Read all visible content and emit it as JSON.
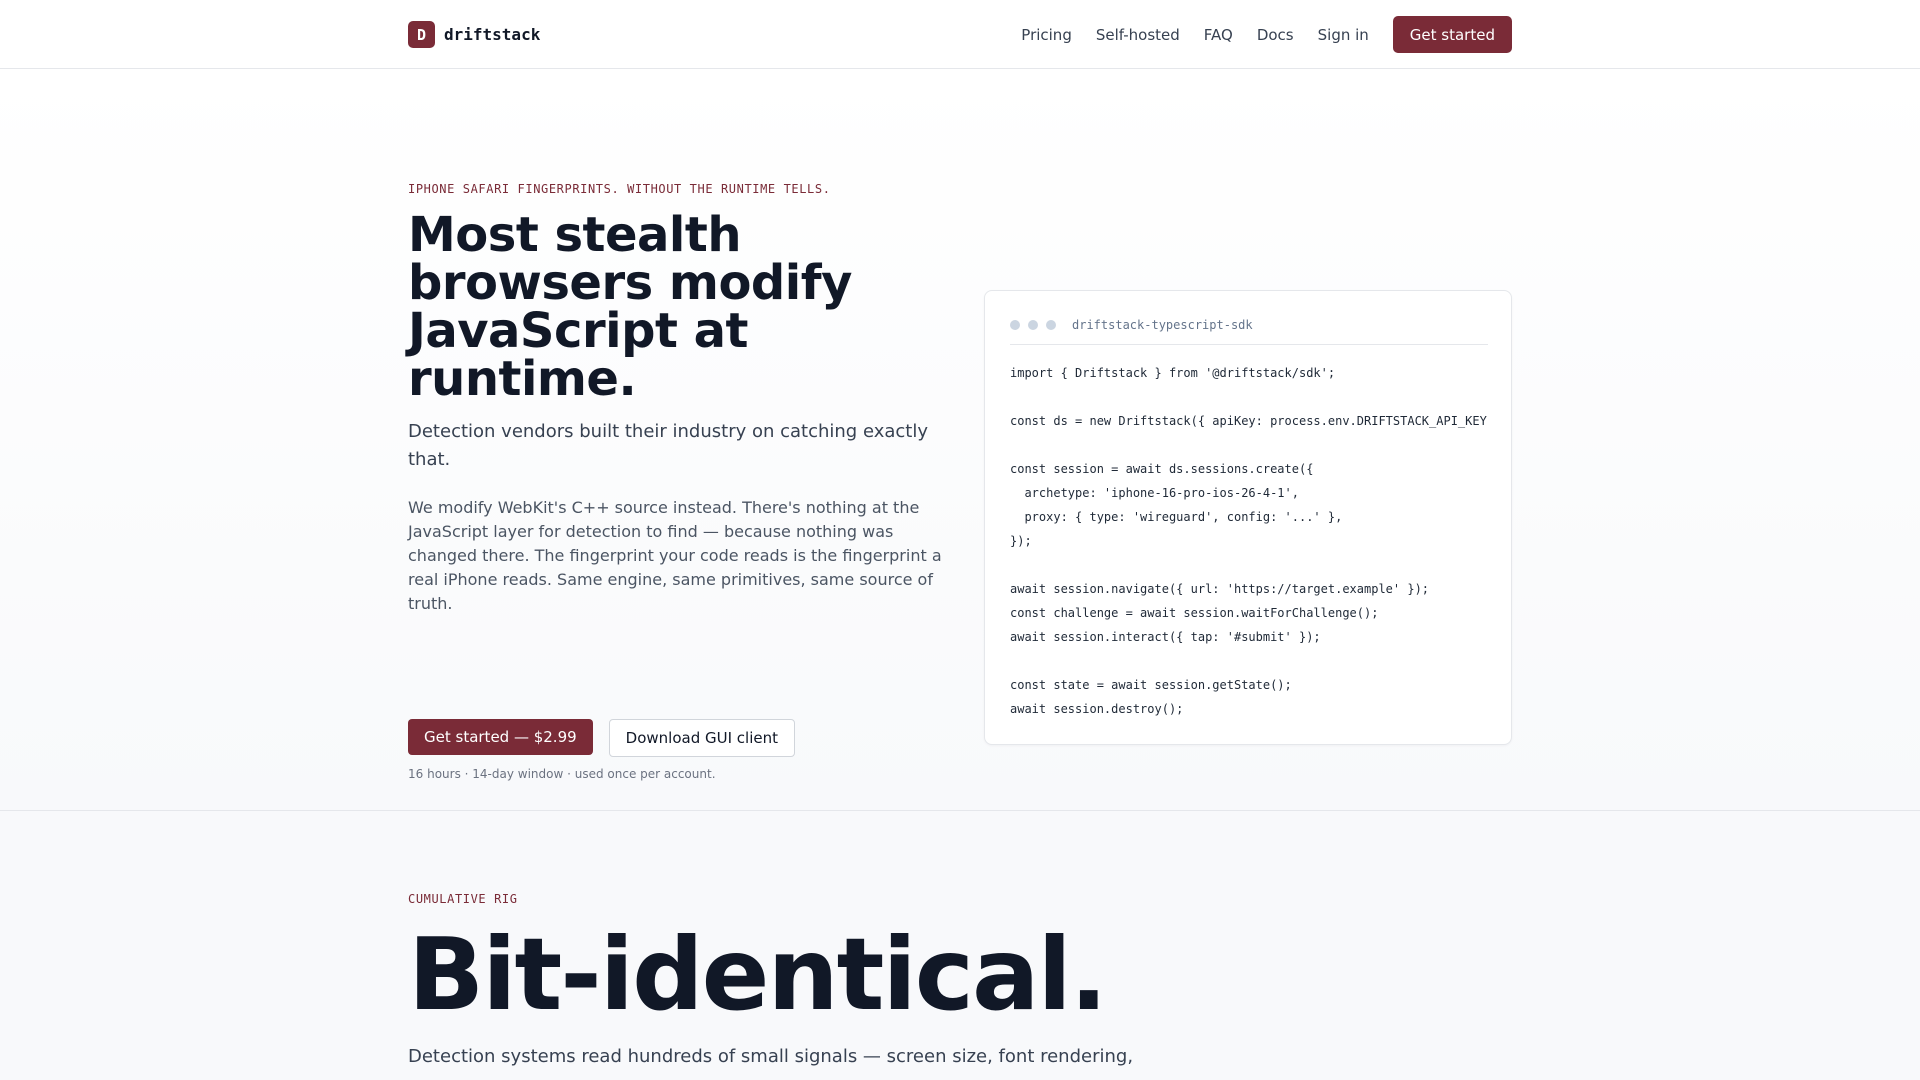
{
  "nav": {
    "brand_mark": "D",
    "brand_name": "driftstack",
    "links": [
      "Pricing",
      "Self-hosted",
      "FAQ",
      "Docs",
      "Sign in"
    ],
    "cta": "Get started"
  },
  "hero": {
    "eyebrow": "IPHONE SAFARI FINGERPRINTS. WITHOUT THE RUNTIME TELLS.",
    "title": "Most stealth browsers modify JavaScript at runtime.",
    "subtitle": "Detection vendors built their industry on catching exactly that.",
    "body": "We modify WebKit's C++ source instead. There's nothing at the JavaScript layer for detection to find — because nothing was changed there. The fingerprint your code reads is the fingerprint a real iPhone reads. Same engine, same primitives, same source of truth.",
    "primary_cta": "Get started — $2.99",
    "secondary_cta": "Download GUI client",
    "note": "16 hours · 14-day window · used once per account."
  },
  "code": {
    "filename": "driftstack-typescript-sdk",
    "lines": [
      "import { Driftstack } from '@driftstack/sdk';",
      "",
      "const ds = new Driftstack({ apiKey: process.env.DRIFTSTACK_API_KEY",
      "",
      "const session = await ds.sessions.create({",
      "  archetype: 'iphone-16-pro-ios-26-4-1',",
      "  proxy: { type: 'wireguard', config: '...' },",
      "});",
      "",
      "await session.navigate({ url: 'https://target.example' });",
      "const challenge = await session.waitForChallenge();",
      "await session.interact({ tap: '#submit' });",
      "",
      "const state = await session.getState();",
      "await session.destroy();"
    ]
  },
  "section2": {
    "eyebrow": "CUMULATIVE RIG",
    "title": "Bit-identical.",
    "body": "Detection systems read hundreds of small signals — screen size, font rendering,"
  },
  "colors": {
    "accent": "#7a2b37",
    "text": "#111827",
    "muted": "#6b7280"
  }
}
